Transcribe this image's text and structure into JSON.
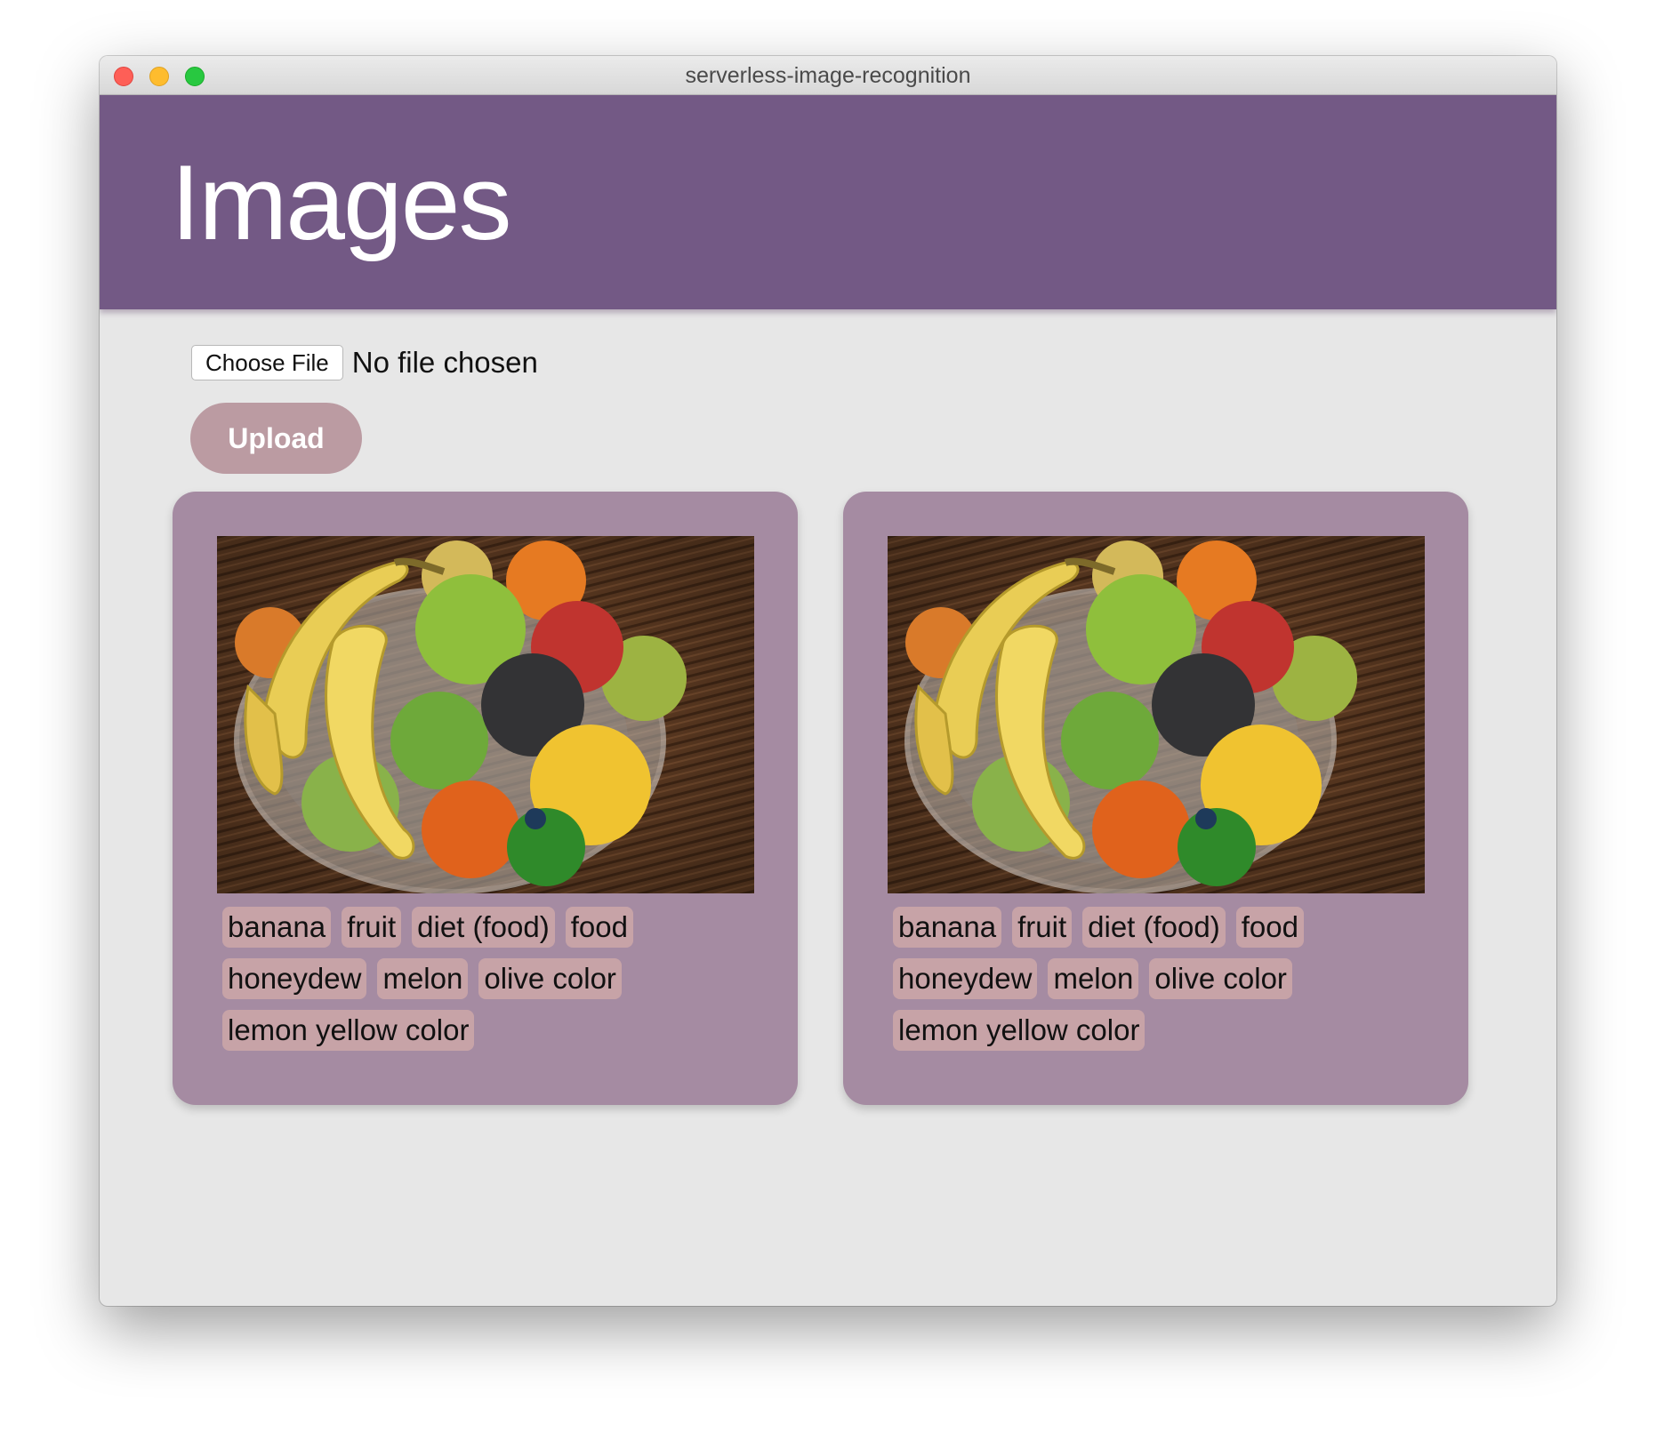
{
  "window": {
    "title": "serverless-image-recognition"
  },
  "header": {
    "title": "Images"
  },
  "upload_form": {
    "choose_file_label": "Choose File",
    "file_status": "No file chosen",
    "upload_label": "Upload"
  },
  "images": [
    {
      "tags": [
        "banana",
        "fruit",
        "diet (food)",
        "food",
        "honeydew",
        "melon",
        "olive color",
        "lemon yellow color"
      ]
    },
    {
      "tags": [
        "banana",
        "fruit",
        "diet (food)",
        "food",
        "honeydew",
        "melon",
        "olive color",
        "lemon yellow color"
      ]
    }
  ],
  "colors": {
    "header": "#735985",
    "card": "#a58ba2",
    "tag": "#c7a3a7",
    "upload_button": "#bb9ba2",
    "background": "#e7e7e7"
  }
}
